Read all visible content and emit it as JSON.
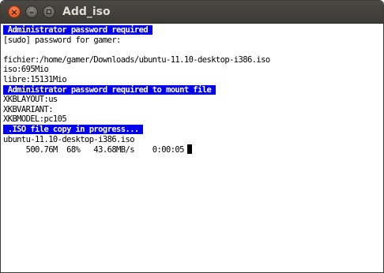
{
  "window": {
    "title": "Add_iso",
    "buttons": {
      "close_icon": "close-icon",
      "minimize_icon": "minimize-icon",
      "maximize_icon": "maximize-icon"
    }
  },
  "terminal": {
    "lines": [
      {
        "text": " Administrator password required ",
        "highlight": true
      },
      {
        "text": "[sudo] password for gamer:",
        "highlight": false
      },
      {
        "text": "",
        "highlight": false
      },
      {
        "text": "fichier:/home/gamer/Downloads/ubuntu-11.10-desktop-i386.iso",
        "highlight": false
      },
      {
        "text": "iso:695Mio",
        "highlight": false
      },
      {
        "text": "libre:15131Mio",
        "highlight": false
      },
      {
        "text": " Administrator password required to mount file ",
        "highlight": true
      },
      {
        "text": "XKBLAYOUT:us",
        "highlight": false
      },
      {
        "text": "XKBVARIANT:",
        "highlight": false
      },
      {
        "text": "XKBMODEL:pc105",
        "highlight": false
      },
      {
        "text": " .ISO file copy in progress... ",
        "highlight": true
      },
      {
        "text": "ubuntu-11.10-desktop-i386.iso",
        "highlight": false
      },
      {
        "text": "     500.76M  68%   43.68MB/s    0:00:05",
        "highlight": false,
        "cursor": true
      }
    ]
  },
  "colors": {
    "highlight_bg": "#0000ee",
    "highlight_fg": "#ffffff",
    "titlebar": "#3c3b37",
    "close_button": "#e25a21"
  }
}
